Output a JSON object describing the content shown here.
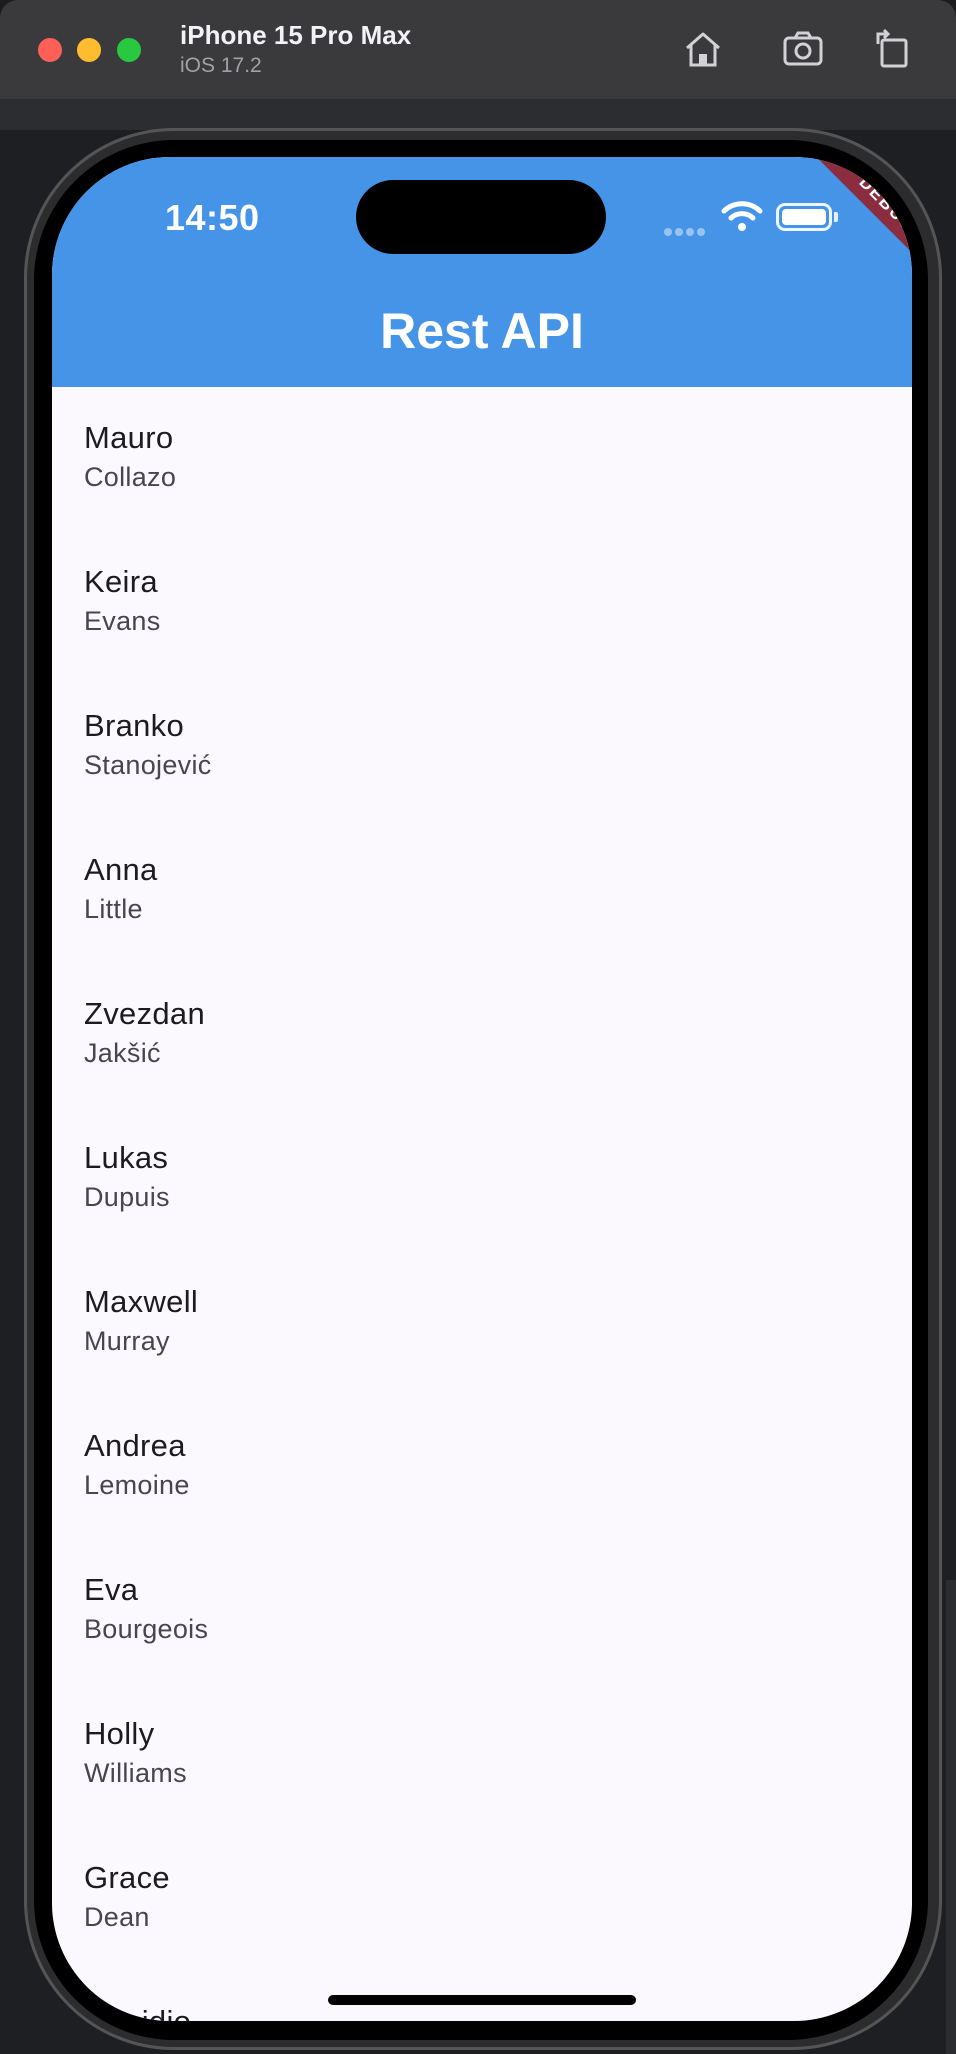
{
  "simulator": {
    "device_name": "iPhone 15 Pro Max",
    "os_version": "iOS 17.2",
    "toolbar": {
      "home_icon": "home-icon",
      "screenshot_icon": "camera-icon",
      "rotate_icon": "rotate-icon"
    }
  },
  "status_bar": {
    "time": "14:50",
    "debug_label": "DEBUG"
  },
  "app_bar": {
    "title": "Rest API",
    "color": "#4694e8"
  },
  "users": [
    {
      "first": "Mauro",
      "last": "Collazo"
    },
    {
      "first": "Keira",
      "last": "Evans"
    },
    {
      "first": "Branko",
      "last": "Stanojević"
    },
    {
      "first": "Anna",
      "last": "Little"
    },
    {
      "first": "Zvezdan",
      "last": "Jakšić"
    },
    {
      "first": "Lukas",
      "last": "Dupuis"
    },
    {
      "first": "Maxwell",
      "last": "Murray"
    },
    {
      "first": "Andrea",
      "last": "Lemoine"
    },
    {
      "first": "Eva",
      "last": "Bourgeois"
    },
    {
      "first": "Holly",
      "last": "Williams"
    },
    {
      "first": "Grace",
      "last": "Dean"
    },
    {
      "first": "Armidio",
      "last": ""
    }
  ]
}
